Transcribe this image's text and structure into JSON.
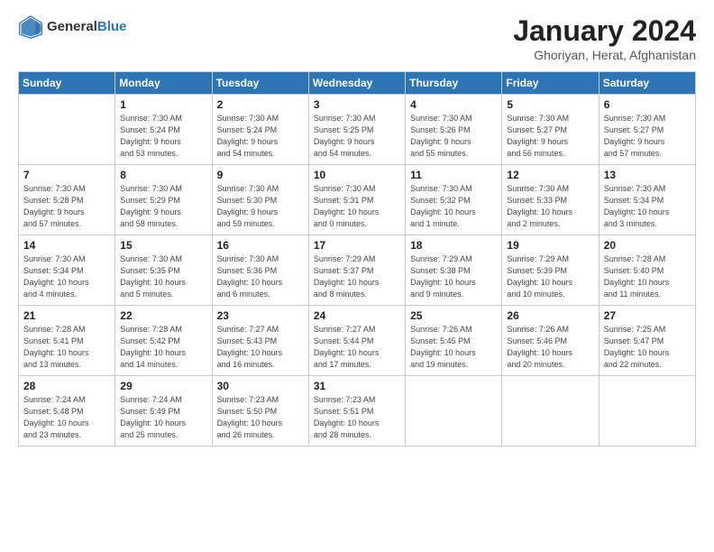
{
  "header": {
    "logo": {
      "general": "General",
      "blue": "Blue"
    },
    "title": "January 2024",
    "location": "Ghoriyan, Herat, Afghanistan"
  },
  "columns": [
    "Sunday",
    "Monday",
    "Tuesday",
    "Wednesday",
    "Thursday",
    "Friday",
    "Saturday"
  ],
  "weeks": [
    [
      {
        "day": "",
        "info": ""
      },
      {
        "day": "1",
        "info": "Sunrise: 7:30 AM\nSunset: 5:24 PM\nDaylight: 9 hours\nand 53 minutes."
      },
      {
        "day": "2",
        "info": "Sunrise: 7:30 AM\nSunset: 5:24 PM\nDaylight: 9 hours\nand 54 minutes."
      },
      {
        "day": "3",
        "info": "Sunrise: 7:30 AM\nSunset: 5:25 PM\nDaylight: 9 hours\nand 54 minutes."
      },
      {
        "day": "4",
        "info": "Sunrise: 7:30 AM\nSunset: 5:26 PM\nDaylight: 9 hours\nand 55 minutes."
      },
      {
        "day": "5",
        "info": "Sunrise: 7:30 AM\nSunset: 5:27 PM\nDaylight: 9 hours\nand 56 minutes."
      },
      {
        "day": "6",
        "info": "Sunrise: 7:30 AM\nSunset: 5:27 PM\nDaylight: 9 hours\nand 57 minutes."
      }
    ],
    [
      {
        "day": "7",
        "info": "Sunrise: 7:30 AM\nSunset: 5:28 PM\nDaylight: 9 hours\nand 57 minutes."
      },
      {
        "day": "8",
        "info": "Sunrise: 7:30 AM\nSunset: 5:29 PM\nDaylight: 9 hours\nand 58 minutes."
      },
      {
        "day": "9",
        "info": "Sunrise: 7:30 AM\nSunset: 5:30 PM\nDaylight: 9 hours\nand 59 minutes."
      },
      {
        "day": "10",
        "info": "Sunrise: 7:30 AM\nSunset: 5:31 PM\nDaylight: 10 hours\nand 0 minutes."
      },
      {
        "day": "11",
        "info": "Sunrise: 7:30 AM\nSunset: 5:32 PM\nDaylight: 10 hours\nand 1 minute."
      },
      {
        "day": "12",
        "info": "Sunrise: 7:30 AM\nSunset: 5:33 PM\nDaylight: 10 hours\nand 2 minutes."
      },
      {
        "day": "13",
        "info": "Sunrise: 7:30 AM\nSunset: 5:34 PM\nDaylight: 10 hours\nand 3 minutes."
      }
    ],
    [
      {
        "day": "14",
        "info": "Sunrise: 7:30 AM\nSunset: 5:34 PM\nDaylight: 10 hours\nand 4 minutes."
      },
      {
        "day": "15",
        "info": "Sunrise: 7:30 AM\nSunset: 5:35 PM\nDaylight: 10 hours\nand 5 minutes."
      },
      {
        "day": "16",
        "info": "Sunrise: 7:30 AM\nSunset: 5:36 PM\nDaylight: 10 hours\nand 6 minutes."
      },
      {
        "day": "17",
        "info": "Sunrise: 7:29 AM\nSunset: 5:37 PM\nDaylight: 10 hours\nand 8 minutes."
      },
      {
        "day": "18",
        "info": "Sunrise: 7:29 AM\nSunset: 5:38 PM\nDaylight: 10 hours\nand 9 minutes."
      },
      {
        "day": "19",
        "info": "Sunrise: 7:29 AM\nSunset: 5:39 PM\nDaylight: 10 hours\nand 10 minutes."
      },
      {
        "day": "20",
        "info": "Sunrise: 7:28 AM\nSunset: 5:40 PM\nDaylight: 10 hours\nand 11 minutes."
      }
    ],
    [
      {
        "day": "21",
        "info": "Sunrise: 7:28 AM\nSunset: 5:41 PM\nDaylight: 10 hours\nand 13 minutes."
      },
      {
        "day": "22",
        "info": "Sunrise: 7:28 AM\nSunset: 5:42 PM\nDaylight: 10 hours\nand 14 minutes."
      },
      {
        "day": "23",
        "info": "Sunrise: 7:27 AM\nSunset: 5:43 PM\nDaylight: 10 hours\nand 16 minutes."
      },
      {
        "day": "24",
        "info": "Sunrise: 7:27 AM\nSunset: 5:44 PM\nDaylight: 10 hours\nand 17 minutes."
      },
      {
        "day": "25",
        "info": "Sunrise: 7:26 AM\nSunset: 5:45 PM\nDaylight: 10 hours\nand 19 minutes."
      },
      {
        "day": "26",
        "info": "Sunrise: 7:26 AM\nSunset: 5:46 PM\nDaylight: 10 hours\nand 20 minutes."
      },
      {
        "day": "27",
        "info": "Sunrise: 7:25 AM\nSunset: 5:47 PM\nDaylight: 10 hours\nand 22 minutes."
      }
    ],
    [
      {
        "day": "28",
        "info": "Sunrise: 7:24 AM\nSunset: 5:48 PM\nDaylight: 10 hours\nand 23 minutes."
      },
      {
        "day": "29",
        "info": "Sunrise: 7:24 AM\nSunset: 5:49 PM\nDaylight: 10 hours\nand 25 minutes."
      },
      {
        "day": "30",
        "info": "Sunrise: 7:23 AM\nSunset: 5:50 PM\nDaylight: 10 hours\nand 26 minutes."
      },
      {
        "day": "31",
        "info": "Sunrise: 7:23 AM\nSunset: 5:51 PM\nDaylight: 10 hours\nand 28 minutes."
      },
      {
        "day": "",
        "info": ""
      },
      {
        "day": "",
        "info": ""
      },
      {
        "day": "",
        "info": ""
      }
    ]
  ]
}
